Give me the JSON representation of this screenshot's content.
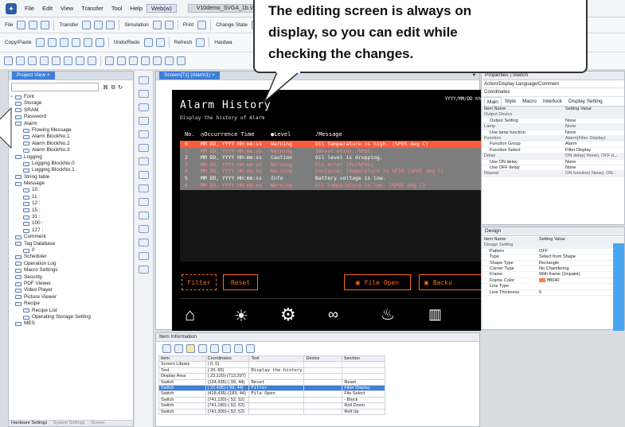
{
  "menubar": {
    "items": [
      "File",
      "Edit",
      "View",
      "Transfer",
      "Tool",
      "Help",
      "Web(w)"
    ],
    "doc_tab": "V10demo_SVGA_1b.V10"
  },
  "toolbar1": {
    "items": [
      "File",
      "Transfer",
      "Simulation",
      "Print",
      "Change State"
    ]
  },
  "toolbar2": {
    "items": [
      "Copy/Paste",
      "Undo/Redo",
      "Refresh",
      "Hardwa"
    ]
  },
  "project_view": {
    "title": "Project View",
    "tree": [
      {
        "label": "Font",
        "level": 0,
        "exp": "+"
      },
      {
        "label": "Storage",
        "level": 0,
        "exp": ""
      },
      {
        "label": "SRAM",
        "level": 0,
        "exp": ""
      },
      {
        "label": "Password",
        "level": 0,
        "exp": ""
      },
      {
        "label": "Alarm",
        "level": 0,
        "exp": "-"
      },
      {
        "label": "Flowing Message",
        "level": 1,
        "exp": ""
      },
      {
        "label": "Alarm BlockNo.1",
        "level": 1,
        "exp": ""
      },
      {
        "label": "Alarm BlockNo.2",
        "level": 1,
        "exp": ""
      },
      {
        "label": "Alarm BlockNo.3",
        "level": 1,
        "exp": ""
      },
      {
        "label": "Logging",
        "level": 0,
        "exp": "-"
      },
      {
        "label": "Logging BlockNo.0",
        "level": 1,
        "exp": ""
      },
      {
        "label": "Logging BlockNo.1",
        "level": 1,
        "exp": ""
      },
      {
        "label": "String table",
        "level": 0,
        "exp": ""
      },
      {
        "label": "Message",
        "level": 0,
        "exp": "-"
      },
      {
        "label": "10 :",
        "level": 1,
        "exp": ""
      },
      {
        "label": "11 :",
        "level": 1,
        "exp": ""
      },
      {
        "label": "12 :",
        "level": 1,
        "exp": ""
      },
      {
        "label": "15 :",
        "level": 1,
        "exp": ""
      },
      {
        "label": "31 :",
        "level": 1,
        "exp": ""
      },
      {
        "label": "100 :",
        "level": 1,
        "exp": ""
      },
      {
        "label": "127 :",
        "level": 1,
        "exp": ""
      },
      {
        "label": "Comment",
        "level": 0,
        "exp": ""
      },
      {
        "label": "Tag Database",
        "level": 0,
        "exp": "-"
      },
      {
        "label": "0",
        "level": 1,
        "exp": ""
      },
      {
        "label": "Scheduler",
        "level": 0,
        "exp": ""
      },
      {
        "label": "Operation Log",
        "level": 0,
        "exp": ""
      },
      {
        "label": "Macro Settings",
        "level": 0,
        "exp": ""
      },
      {
        "label": "Security",
        "level": 0,
        "exp": ""
      },
      {
        "label": "PDF Viewer",
        "level": 0,
        "exp": ""
      },
      {
        "label": "Video Player",
        "level": 0,
        "exp": ""
      },
      {
        "label": "Picture Viewer",
        "level": 0,
        "exp": ""
      },
      {
        "label": "Recipe",
        "level": 0,
        "exp": "-"
      },
      {
        "label": "Recipe List",
        "level": 1,
        "exp": ""
      },
      {
        "label": "Operating Storage Setting",
        "level": 1,
        "exp": ""
      },
      {
        "label": "MES",
        "level": 0,
        "exp": ""
      }
    ],
    "bottom_tabs": [
      "Hardware Settings",
      "System Settings",
      "Screen"
    ]
  },
  "editor": {
    "tab": "Screen[71] (Alarm1)"
  },
  "hmi": {
    "title": "Alarm History",
    "subtitle": "Display the history of Alarm",
    "date": "YYYY/MM/DD hh",
    "headers": {
      "no": "No.",
      "time": "Occurrence Time",
      "level": "Level",
      "message": "Message"
    },
    "rows": [
      {
        "no": "0",
        "time": "MM DD, YYYY HH:mm:ss",
        "level": "Warning",
        "msg": "Oil temperature is high. (%POS deg C)",
        "color": "#ff8a8a"
      },
      {
        "no": "1",
        "time": "MM DD, YYYY HH:mm:ss",
        "level": "Warning",
        "msg": "Sensor error. %POS",
        "color": "#ff8a8a"
      },
      {
        "no": "2",
        "time": "MM DD, YYYY HH:mm:ss",
        "level": "Caution",
        "msg": "Oil level is dropping.",
        "color": "#ffffff"
      },
      {
        "no": "3",
        "time": "MM DD, YYYY HH:mm:ss",
        "level": "Warning",
        "msg": "PLC error (PLC%POS)",
        "color": "#ff8a8a"
      },
      {
        "no": "4",
        "time": "MM DD, YYYY HH:mm:ss",
        "level": "Warning",
        "msg": "Container temperature is %P1S (%POS deg C)",
        "color": "#ff8a8a"
      },
      {
        "no": "5",
        "time": "MM DD, YYYY HH:mm:ss",
        "level": "Info",
        "msg": "Battery voltage is low.",
        "color": "#ffffff"
      },
      {
        "no": "6",
        "time": "MM DD, YYYY HH:mm:ss",
        "level": "Warning",
        "msg": "Oil temperature is low. (%POS deg C)",
        "color": "#ff8a8a"
      }
    ],
    "buttons": {
      "filter": "Filter",
      "reset": "Reset",
      "file_open": "File Open",
      "backup": "Backu"
    }
  },
  "item_info": {
    "title": "Item Information",
    "columns": [
      "Item",
      "Coordinates",
      "Text",
      "Device",
      "function"
    ],
    "rows": [
      {
        "item": "Screen Library",
        "coords": "( 0, 0)",
        "text": "",
        "device": "",
        "func": "",
        "sel": false
      },
      {
        "item": "Text",
        "coords": "( 20, 65)",
        "text": "Display the history",
        "device": "",
        "func": "",
        "sel": false
      },
      {
        "item": "Display Area",
        "coords": "( 23,120)-(713,297)",
        "text": "",
        "device": "",
        "func": "",
        "sel": false
      },
      {
        "item": "Switch",
        "coords": "(134,435)-( 99, 44)",
        "text": "Reset",
        "device": "",
        "func": "Reset",
        "sel": false
      },
      {
        "item": "Switch",
        "coords": "( 22,435)-( 99, 44)",
        "text": "Filter",
        "device": "",
        "func": "Filter Display",
        "sel": true
      },
      {
        "item": "Switch",
        "coords": "(418,435)-(183, 44)",
        "text": "File Open",
        "device": "",
        "func": "File Select",
        "sel": false
      },
      {
        "item": "Switch",
        "coords": "(741,120)-( 52, 52)",
        "text": "",
        "device": "",
        "func": "- Block",
        "sel": false
      },
      {
        "item": "Switch",
        "coords": "(741,180)-( 52, 52)",
        "text": "",
        "device": "",
        "func": "Roll Down",
        "sel": false
      },
      {
        "item": "Switch",
        "coords": "(741,300)-( 52, 52)",
        "text": "",
        "device": "",
        "func": "Roll Up",
        "sel": false
      }
    ]
  },
  "properties": {
    "title": "Properties | Switch",
    "action": "Action/Display Language/Comment",
    "coordinates": "Coordinates",
    "tabs": [
      "Main",
      "Style",
      "Macro",
      "Interlock",
      "Display Setting"
    ],
    "cols": [
      "Item Name",
      "Setting Value"
    ],
    "rows": [
      {
        "k": "Output Device",
        "v": "",
        "group": true
      },
      {
        "k": "Output Setting",
        "v": "None",
        "group": false
      },
      {
        "k": "Lamp",
        "v": "None",
        "group": true
      },
      {
        "k": "Use lamp function",
        "v": "None",
        "group": false
      },
      {
        "k": "Function",
        "v": "Alarm(Filter Display)",
        "group": true
      },
      {
        "k": "Function Group",
        "v": "Alarm",
        "group": false
      },
      {
        "k": "Function Select",
        "v": "Filter Display",
        "group": false
      },
      {
        "k": "Delay",
        "v": "ON delay( None), OFF d...",
        "group": true
      },
      {
        "k": "Use ON delay",
        "v": "None",
        "group": false
      },
      {
        "k": "Use OFF delay",
        "v": "None",
        "group": false
      },
      {
        "k": "Repeat",
        "v": "ON function( None), ON...",
        "group": true
      }
    ]
  },
  "design": {
    "title": "Design",
    "cols": [
      "Item Name",
      "Setting Value"
    ],
    "rows": [
      {
        "k": "Design Setting",
        "v": "",
        "group": true
      },
      {
        "k": "Pattern",
        "v": "OFF",
        "group": false
      },
      {
        "k": "Type",
        "v": "Select from Shape",
        "group": false
      },
      {
        "k": "Shape Type",
        "v": "Rectangle",
        "group": false
      },
      {
        "k": "Corner Type",
        "v": "No Chamfering",
        "group": false
      },
      {
        "k": "Frame",
        "v": "With frame (Unpaint)",
        "group": false
      },
      {
        "k": "Frame Color",
        "v": "ff8040",
        "group": false
      },
      {
        "k": "Line Type",
        "v": "",
        "group": false
      },
      {
        "k": "Line Thickness",
        "v": "5",
        "group": false
      }
    ],
    "frame_color": "#ff8040"
  },
  "callout": {
    "lines": [
      "The editing screen is always on",
      "display, so you can edit while",
      "checking the changes."
    ]
  },
  "colors": {
    "accent": "#3f7fd6",
    "orange": "#ff6a1a",
    "hmi_bg": "#000000",
    "table_row": "#ff8a8a"
  }
}
